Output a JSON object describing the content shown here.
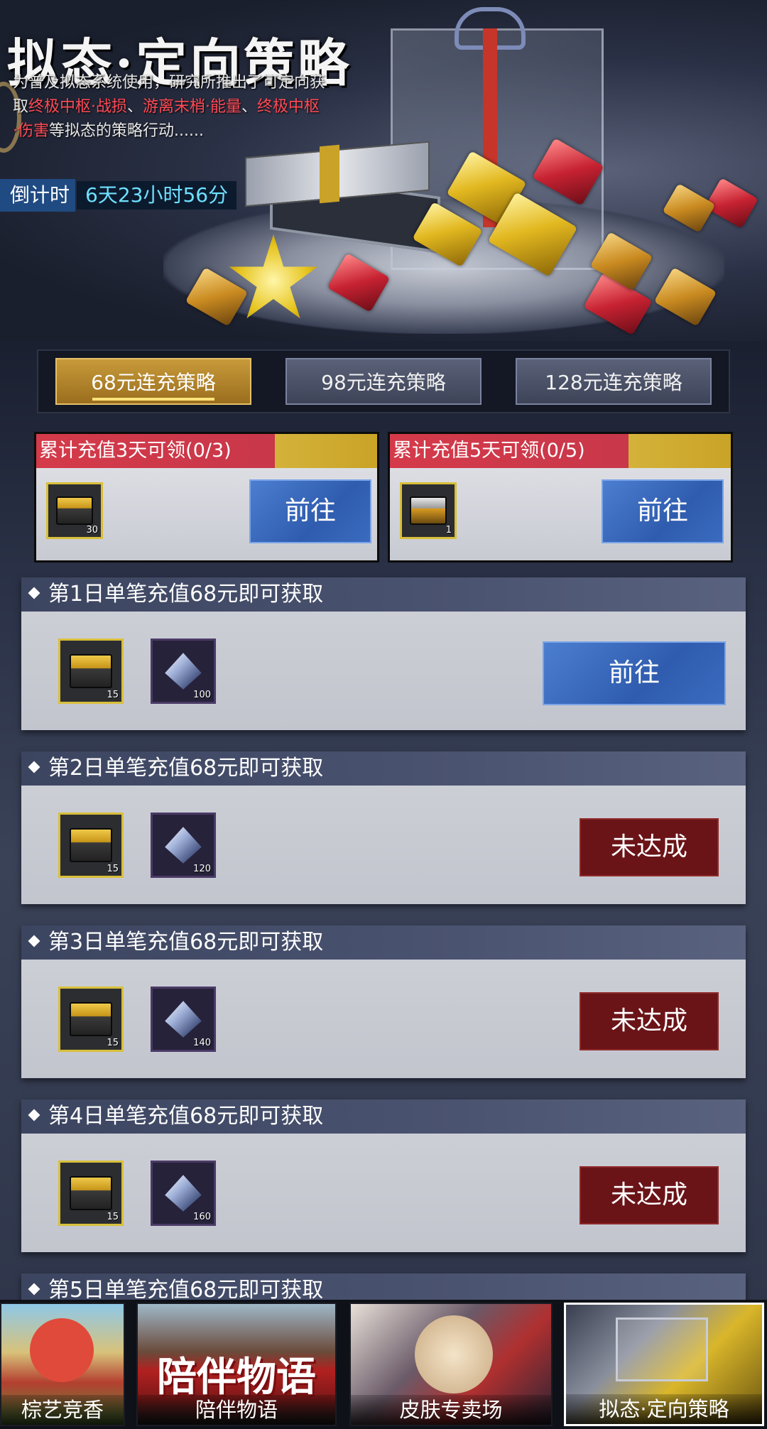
{
  "header": {
    "title": "拟态·定向策略",
    "desc_line1": "为普及拟态系统使用，研究所推出了可定向获",
    "desc_line2_a": "取",
    "desc_line2_red1": "终极中枢·战损",
    "desc_line2_sep1": "、",
    "desc_line2_red2": "游离末梢·能量",
    "desc_line2_sep2": "、",
    "desc_line2_red3": "终极中枢",
    "desc_line3_red": "·伤害",
    "desc_line3_rest": "等拟态的策略行动......",
    "countdown_label": "倒计时",
    "countdown_value": "6天23小时56分"
  },
  "tabs": [
    {
      "label": "68元连充策略",
      "active": true
    },
    {
      "label": "98元连充策略",
      "active": false
    },
    {
      "label": "128元连充策略",
      "active": false
    }
  ],
  "cumulative": [
    {
      "title": "累计充值3天可领(0/3)",
      "item_qty": "30",
      "button": "前往"
    },
    {
      "title": "累计充值5天可领(0/5)",
      "item_qty": "1",
      "button": "前往"
    }
  ],
  "days": [
    {
      "title": "第1日单笔充值68元即可获取",
      "chest_qty": "15",
      "gem_qty": "100",
      "button": "前往",
      "status": "go"
    },
    {
      "title": "第2日单笔充值68元即可获取",
      "chest_qty": "15",
      "gem_qty": "120",
      "button": "未达成",
      "status": "fail"
    },
    {
      "title": "第3日单笔充值68元即可获取",
      "chest_qty": "15",
      "gem_qty": "140",
      "button": "未达成",
      "status": "fail"
    },
    {
      "title": "第4日单笔充值68元即可获取",
      "chest_qty": "15",
      "gem_qty": "160",
      "button": "未达成",
      "status": "fail"
    },
    {
      "title": "第5日单笔充值68元即可获取"
    }
  ],
  "bottom_nav": [
    {
      "label": "棕艺竞香"
    },
    {
      "label": "陪伴物语",
      "banner_text": "陪伴物语"
    },
    {
      "label": "皮肤专卖场"
    },
    {
      "label": "拟态·定向策略",
      "active": true
    }
  ]
}
